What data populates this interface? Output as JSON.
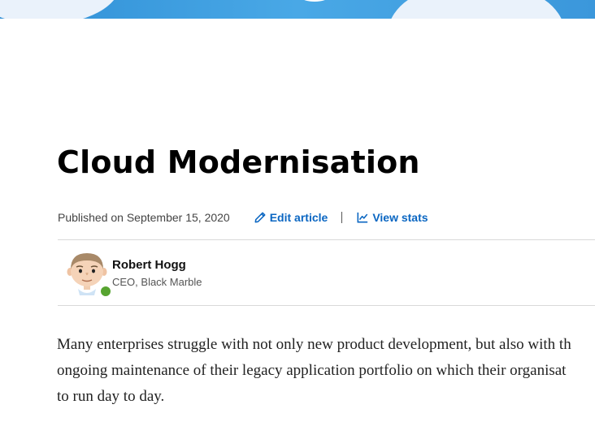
{
  "article": {
    "title": "Cloud Modernisation",
    "published": "Published on September 15, 2020",
    "edit_label": "Edit article",
    "stats_label": "View stats"
  },
  "author": {
    "name": "Robert Hogg",
    "role": "CEO, Black Marble",
    "status_color": "#57a430"
  },
  "body": {
    "lines": [
      "Many enterprises struggle with not only new product development, but also with th",
      "ongoing maintenance of their legacy application portfolio on which their organisat",
      "to run day to day."
    ]
  },
  "theme": {
    "accent": "#0a66c2"
  }
}
